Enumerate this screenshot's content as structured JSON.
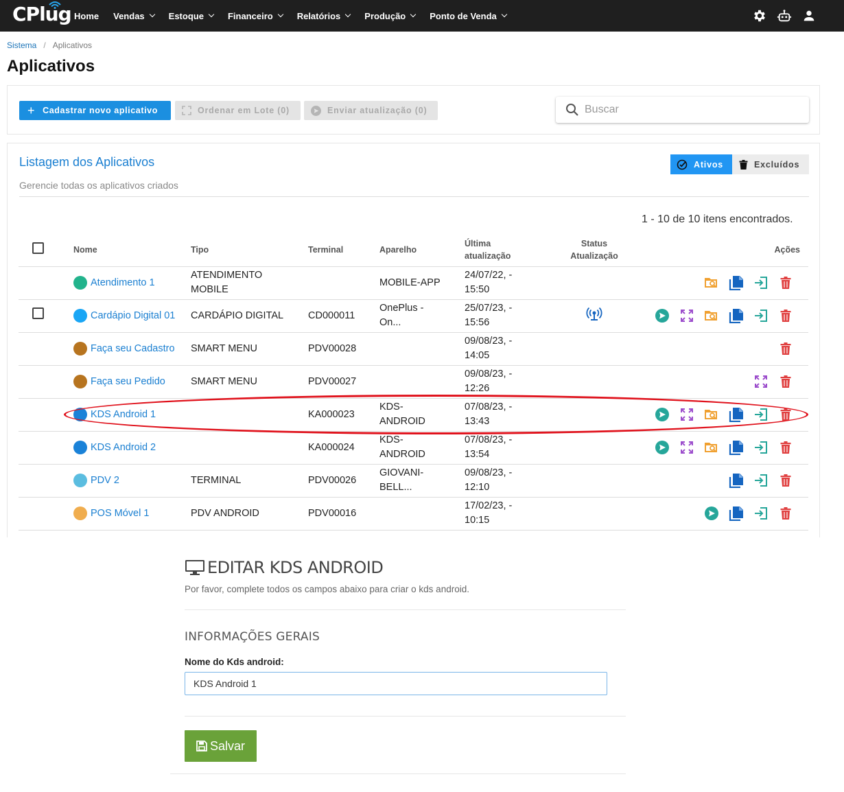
{
  "navbar": {
    "logo": "CPlug",
    "items": [
      {
        "label": "Home",
        "dropdown": false
      },
      {
        "label": "Vendas",
        "dropdown": true
      },
      {
        "label": "Estoque",
        "dropdown": true
      },
      {
        "label": "Financeiro",
        "dropdown": true
      },
      {
        "label": "Relatórios",
        "dropdown": true
      },
      {
        "label": "Produção",
        "dropdown": true
      },
      {
        "label": "Ponto de Venda",
        "dropdown": true
      }
    ],
    "right_icons": [
      "gear-icon",
      "robot-icon",
      "user-icon"
    ]
  },
  "breadcrumb": {
    "root": "Sistema",
    "separator": "/",
    "current": "Aplicativos"
  },
  "page_title": "Aplicativos",
  "toolbar": {
    "new_app": "Cadastrar novo aplicativo",
    "batch_order": "Ordenar em Lote (0)",
    "send_update": "Enviar atualização (0)",
    "search_placeholder": "Buscar"
  },
  "list": {
    "title": "Listagem dos Aplicativos",
    "subtitle": "Gerencie todas os aplicativos criados",
    "filter_active": "Ativos",
    "filter_deleted": "Excluídos",
    "count": "1 - 10 de 10 itens encontrados.",
    "columns": {
      "name": "Nome",
      "type": "Tipo",
      "terminal": "Terminal",
      "device": "Aparelho",
      "last_update_1": "Última",
      "last_update_2": "atualização",
      "status_1": "Status",
      "status_2": "Atualização",
      "actions": "Ações"
    },
    "rows": [
      {
        "checkbox": false,
        "dot": "#22b38c",
        "name": "Atendimento 1",
        "type": "ATENDIMENTO MOBILE",
        "terminal": "",
        "device": "MOBILE-APP",
        "update_1": "24/07/22, -",
        "update_2": "15:50",
        "status": false,
        "actions": [
          "search",
          "copy",
          "login",
          "delete"
        ]
      },
      {
        "checkbox": true,
        "dot": "#1aa6f5",
        "name": "Cardápio Digital 01",
        "type": "CARDÁPIO DIGITAL",
        "terminal": "CD000011",
        "device": "OnePlus - On...",
        "update_1": "25/07/23, -",
        "update_2": "15:56",
        "status": true,
        "actions": [
          "send",
          "order",
          "search",
          "copy",
          "login",
          "delete"
        ]
      },
      {
        "checkbox": false,
        "dot": "#b7741f",
        "name": "Faça seu Cadastro",
        "type": "SMART MENU",
        "terminal": "PDV00028",
        "device": "",
        "update_1": "09/08/23, -",
        "update_2": "14:05",
        "status": false,
        "actions": [
          "delete"
        ]
      },
      {
        "checkbox": false,
        "dot": "#b7741f",
        "name": "Faça seu Pedido",
        "type": "SMART MENU",
        "terminal": "PDV00027",
        "device": "",
        "update_1": "09/08/23, -",
        "update_2": "12:26",
        "status": false,
        "actions": [
          "order",
          "delete"
        ]
      },
      {
        "checkbox": false,
        "dot": "#1a82d8",
        "name": "KDS Android 1",
        "type": "",
        "terminal": "KA000023",
        "device": "KDS- ANDROID",
        "update_1": "07/08/23, -",
        "update_2": "13:43",
        "status": false,
        "actions": [
          "send",
          "order",
          "search",
          "copy",
          "login",
          "delete"
        ]
      },
      {
        "checkbox": false,
        "dot": "#1a82d8",
        "name": "KDS Android 2",
        "type": "",
        "terminal": "KA000024",
        "device": "KDS- ANDROID",
        "update_1": "07/08/23, -",
        "update_2": "13:54",
        "status": false,
        "actions": [
          "send",
          "order",
          "search",
          "copy",
          "login",
          "delete"
        ]
      },
      {
        "checkbox": false,
        "dot": "#5bbde0",
        "name": "PDV 2",
        "type": "TERMINAL",
        "terminal": "PDV00026",
        "device": "GIOVANI- BELL...",
        "update_1": "09/08/23, -",
        "update_2": "12:10",
        "status": false,
        "actions": [
          "copy",
          "login",
          "delete"
        ]
      },
      {
        "checkbox": false,
        "dot": "#f0ad4e",
        "name": "POS Móvel 1",
        "type": "PDV ANDROID",
        "terminal": "PDV00016",
        "device": "",
        "update_1": "17/02/23, -",
        "update_2": "10:15",
        "status": false,
        "actions": [
          "send",
          "copy",
          "login",
          "delete"
        ]
      }
    ]
  },
  "edit_form": {
    "title": "EDITAR KDS ANDROID",
    "subtitle": "Por favor, complete todos os campos abaixo para criar o kds android.",
    "section": "INFORMAÇÕES GERAIS",
    "field_label": "Nome do Kds android:",
    "field_value": "KDS Android 1",
    "save": "Salvar"
  },
  "colors": {
    "primary": "#1b8fe0",
    "navbar": "#1f1f1f",
    "link": "#1a7fd1",
    "delete": "#e04040",
    "send": "#26a69a",
    "order": "#9c4dcc",
    "search": "#f0a030",
    "copy": "#1565c0",
    "login": "#26a69a",
    "save": "#6aa239",
    "highlight": "#e0121c"
  }
}
